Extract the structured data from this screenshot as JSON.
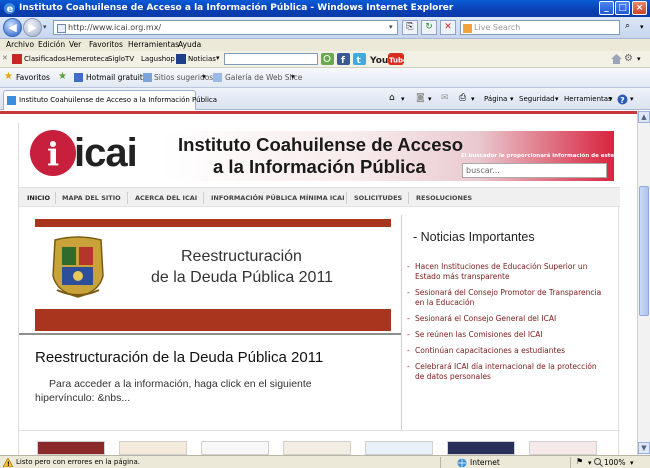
{
  "window": {
    "title": "Instituto Coahuilense de Acceso a la Información Pública - Windows Internet Explorer"
  },
  "address_bar": {
    "url": "http://www.icai.org.mx/",
    "search_placeholder": "Live Search"
  },
  "menu": [
    "Archivo",
    "Edición",
    "Ver",
    "Favoritos",
    "Herramientas",
    "Ayuda"
  ],
  "link_toolbar": {
    "items": [
      "Clasificados",
      "Hemeroteca",
      "SigloTV",
      "Lagushop"
    ],
    "news_label": "Noticias",
    "youtube": "YouTube"
  },
  "favorites_bar": {
    "favorites_label": "Favoritos",
    "items": [
      "Hotmail gratuito",
      "Sitios sugeridos",
      "Galería de Web Slice"
    ]
  },
  "tab": {
    "label": "Instituto Coahuilense de Acceso a la Información Pública"
  },
  "command_bar": [
    "Página",
    "Seguridad",
    "Herramientas"
  ],
  "site": {
    "logo_text": "icai",
    "logo_letter": "i",
    "header_title_line1": "Instituto Coahuilense de Acceso",
    "header_title_line2": "a la Información Pública",
    "search_label": "El buscador le proporcionará información de este sitio",
    "search_placeholder": "buscar...",
    "nav": [
      "INICIO",
      "MAPA DEL SITIO",
      "ACERCA DEL ICAI",
      "INFORMACIÓN PÚBLICA MÍNIMA ICAI",
      "SOLICITUDES",
      "RESOLUCIONES"
    ],
    "feature": {
      "line1": "Reestructuración",
      "line2": "de la Deuda Pública 2011"
    },
    "article": {
      "title": "Reestructuración de la Deuda Pública 2011",
      "body": "Para acceder a la información, haga click en el siguiente hipervínculo: &nbs..."
    },
    "news": {
      "title": "- Noticias Importantes",
      "items": [
        "Hacen Instituciones de Educación Superior un Estado más transparente",
        "Sesionará del Consejo Promotor de Transparencia en la Educación",
        "Sesionará el Consejo General del ICAI",
        "Se reúnen las Comisiones del ICAI",
        "Continúan capacitaciones a estudiantes",
        "Celebrará ICAI día internacional de la protección de datos personales"
      ]
    }
  },
  "status_bar": {
    "message": "Listo pero con errores en la página.",
    "zone": "Internet",
    "zoom": "100%"
  },
  "colors": {
    "brand_red": "#c81f3c",
    "feature_band": "#a9351e",
    "title_bar": "#0a4fcb"
  }
}
